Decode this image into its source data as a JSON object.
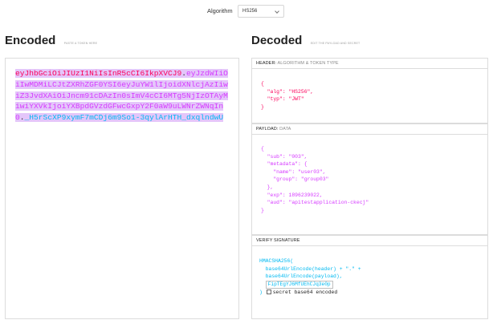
{
  "algorithm": {
    "label": "Algorithm",
    "selected": "HS256"
  },
  "encoded": {
    "title": "Encoded",
    "hint": "PASTE A TOKEN HERE",
    "token_header": "eyJhbGciOiJIUzI1NiIsInR5cCI6IkpXVCJ9",
    "token_payload": "eyJzdWIiOiIwMDMiLCJtZXRhZGF0YSI6eyJuYW1lIjoidXNlcjAzIiwiZ3JvdXAiOiJncm91cDAzIn0sImV4cCI6MTg5NjIzOTAyMiwiYXVkIjoiYXBpdGVzdGFwcGxpY2F0aW9uLWNrZWNqIn0",
    "token_signature": "_H5rScXP9xymF7mCDj6m9So1-3qylArHTH_dxqlndwU",
    "dot": "."
  },
  "decoded": {
    "title": "Decoded",
    "hint": "EDIT THE PAYLOAD AND SECRET",
    "header_panel": {
      "title": "HEADER:",
      "subtitle": "ALGORITHM & TOKEN TYPE",
      "lines": [
        "{",
        "  \"alg\": \"HS256\",",
        "  \"typ\": \"JWT\"",
        "}"
      ]
    },
    "payload_panel": {
      "title": "PAYLOAD:",
      "subtitle": "DATA",
      "lines": [
        "{",
        "  \"sub\": \"003\",",
        "  \"metadata\": {",
        "    \"name\": \"user03\",",
        "    \"group\": \"group03\"",
        "  },",
        "  \"exp\": 1896239022,",
        "  \"aud\": \"apitestapplication-ckecj\"",
        "}"
      ]
    },
    "verify_panel": {
      "title": "VERIFY SIGNATURE",
      "fn_open": "HMACSHA256(",
      "line_header": "  base64UrlEncode(header) + \".\" +",
      "line_payload": "  base64UrlEncode(payload),",
      "secret_value": "FipTEgYJ6MfUEhCJq3e0p",
      "close": ")",
      "checkbox_label": "secret base64 encoded"
    }
  },
  "colors": {
    "header": "#fb015b",
    "payload": "#d63aff",
    "signature": "#00b9f1",
    "highlight": "#e4c6fa"
  }
}
